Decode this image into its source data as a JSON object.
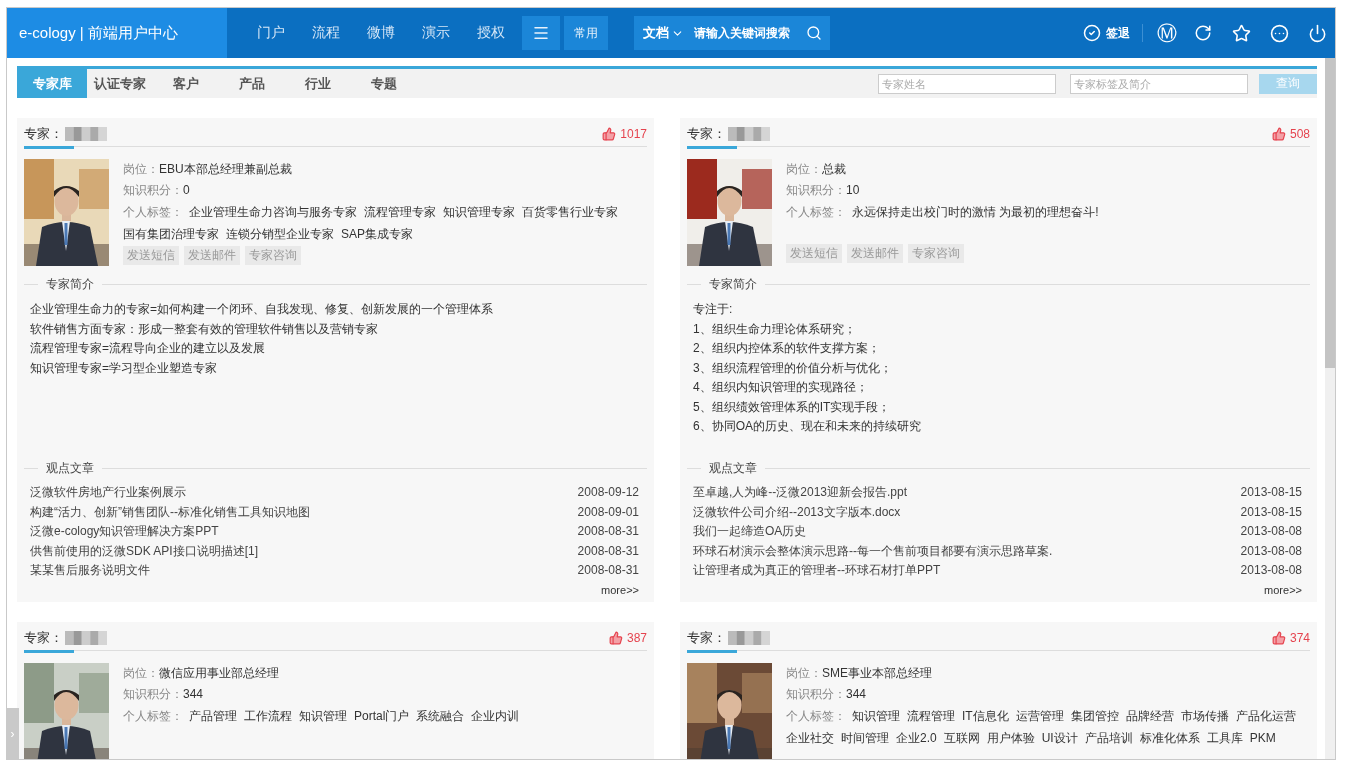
{
  "header": {
    "logo": "e-cology | 前端用户中心",
    "nav": [
      "门户",
      "流程",
      "微博",
      "演示",
      "授权"
    ],
    "shortcut": "常用",
    "search": {
      "category": "文档",
      "placeholder": "请输入关键词搜索"
    },
    "signout": "签退",
    "m_badge": "Ⓜ"
  },
  "tabs": [
    {
      "label": "专家库",
      "selected": true
    },
    {
      "label": "认证专家",
      "selected": false
    },
    {
      "label": "客户",
      "selected": false
    },
    {
      "label": "产品",
      "selected": false
    },
    {
      "label": "行业",
      "selected": false
    },
    {
      "label": "专题",
      "selected": false
    }
  ],
  "filters": {
    "name_placeholder": "专家姓名",
    "tag_placeholder": "专家标签及简介",
    "button": "查询"
  },
  "experts": [
    {
      "label": "专家：",
      "likes": "1017",
      "position_label": "岗位：",
      "position": "EBU本部总经理兼副总裁",
      "score_label": "知识积分：",
      "score": "0",
      "tags_label": "个人标签：",
      "tags": [
        "企业管理生命力咨询与服务专家",
        "流程管理专家",
        "知识管理专家",
        "百货零售行业专家",
        "国有集团治理专家",
        "连锁分销型企业专家",
        "SAP集成专家"
      ],
      "actions": [
        "发送短信",
        "发送邮件",
        "专家咨询"
      ],
      "intro_title": "专家简介",
      "intro": [
        "企业管理生命力的专家=如何构建一个闭环、自我发现、修复、创新发展的一个管理体系",
        "软件销售方面专家：形成一整套有效的管理软件销售以及营销专家",
        "流程管理专家=流程导向企业的建立以及发展",
        "知识管理专家=学习型企业塑造专家"
      ],
      "articles_title": "观点文章",
      "articles": [
        {
          "title": "泛微软件房地产行业案例展示",
          "date": "2008-09-12"
        },
        {
          "title": "构建“活力、创新”销售团队--标准化销售工具知识地图",
          "date": "2008-09-01"
        },
        {
          "title": "泛微e-cology知识管理解决方案PPT",
          "date": "2008-08-31"
        },
        {
          "title": "供售前使用的泛微SDK API接口说明描述[1]",
          "date": "2008-08-31"
        },
        {
          "title": "某某售后服务说明文件",
          "date": "2008-08-31"
        }
      ],
      "more": "more>>"
    },
    {
      "label": "专家：",
      "likes": "508",
      "position_label": "岗位：",
      "position": "总裁",
      "score_label": "知识积分：",
      "score": "10",
      "tags_label": "个人标签：",
      "tags": [
        "永远保持走出校门时的激情 为最初的理想奋斗!"
      ],
      "actions": [
        "发送短信",
        "发送邮件",
        "专家咨询"
      ],
      "intro_title": "专家简介",
      "intro": [
        "专注于:",
        "1、组织生命力理论体系研究；",
        "2、组织内控体系的软件支撑方案；",
        "3、组织流程管理的价值分析与优化；",
        "4、组织内知识管理的实现路径；",
        "5、组织绩效管理体系的IT实现手段；",
        "6、协同OA的历史、现在和未来的持续研究"
      ],
      "articles_title": "观点文章",
      "articles": [
        {
          "title": "至卓越,人为峰--泛微2013迎新会报告.ppt",
          "date": "2013-08-15"
        },
        {
          "title": "泛微软件公司介绍--2013文字版本.docx",
          "date": "2013-08-15"
        },
        {
          "title": "我们一起缔造OA历史",
          "date": "2013-08-08"
        },
        {
          "title": "环球石材演示会整体演示思路--每一个售前项目都要有演示思路草案.",
          "date": "2013-08-08"
        },
        {
          "title": "让管理者成为真正的管理者--环球石材打单PPT",
          "date": "2013-08-08"
        }
      ],
      "more": "more>>"
    },
    {
      "label": "专家：",
      "likes": "387",
      "position_label": "岗位：",
      "position": "微信应用事业部总经理",
      "score_label": "知识积分：",
      "score": "344",
      "tags_label": "个人标签：",
      "tags": [
        "产品管理",
        "工作流程",
        "知识管理",
        "Portal门户",
        "系统融合",
        "企业内训"
      ]
    },
    {
      "label": "专家：",
      "likes": "374",
      "position_label": "岗位：",
      "position": "SME事业本部总经理",
      "score_label": "知识积分：",
      "score": "344",
      "tags_label": "个人标签：",
      "tags": [
        "知识管理",
        "流程管理",
        "IT信息化",
        "运营管理",
        "集团管控",
        "品牌经营",
        "市场传播",
        "产品化运营",
        "企业社交",
        "时间管理",
        "企业2.0",
        "互联网",
        "用户体验",
        "UI设计",
        "产品培训",
        "标准化体系",
        "工具库",
        "PKM"
      ]
    }
  ],
  "side_toggle": "›"
}
